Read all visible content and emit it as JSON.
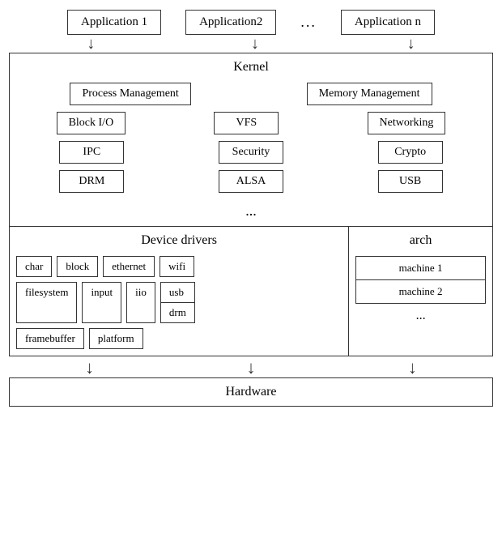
{
  "apps": {
    "app1": "Application 1",
    "app2": "Application2",
    "ellipsis_middle": "...",
    "appn": "Application n"
  },
  "kernel": {
    "title": "Kernel",
    "row1": [
      "Process Management",
      "Memory Management"
    ],
    "row2": [
      "Block I/O",
      "VFS",
      "Networking"
    ],
    "row3": [
      "IPC",
      "Security",
      "Crypto"
    ],
    "row4": [
      "DRM",
      "ALSA",
      "USB"
    ],
    "dots": "..."
  },
  "device_drivers": {
    "title": "Device drivers",
    "row1": [
      "char",
      "block",
      "ethernet",
      "wifi"
    ],
    "row2_left": [
      "filesystem",
      "input"
    ],
    "stacked_right": [
      "usb",
      "drm"
    ],
    "row2_iio": "iio",
    "row3": [
      "framebuffer",
      "platform"
    ]
  },
  "arch": {
    "title": "arch",
    "machines": [
      "machine 1",
      "machine 2"
    ],
    "dots": "..."
  },
  "hardware": "Hardware",
  "arrows": {
    "down": "↓"
  }
}
